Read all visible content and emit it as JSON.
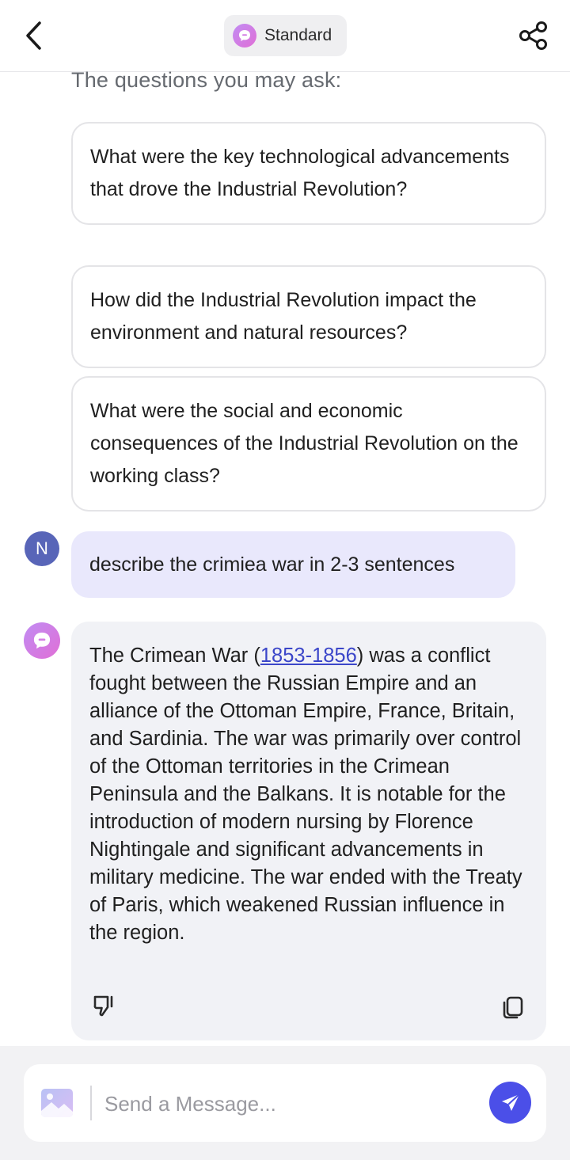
{
  "header": {
    "mode_label": "Standard"
  },
  "suggestions": {
    "title": "The questions you may ask:",
    "items": [
      "What were the key technological advancements that drove the Industrial Revolution?",
      "How did the Industrial Revolution impact the environment and natural resources?",
      "What were the social and economic consequences of the Industrial Revolution on the working class?"
    ]
  },
  "chat": {
    "user_initial": "N",
    "user_message": "describe the crimiea war in 2-3 sentences",
    "bot_reply": {
      "before_link": "The Crimean War (",
      "link_text": "1853-1856",
      "after_link": ") was a conflict fought between the Russian Empire and an alliance of the Ottoman Empire, France, Britain, and Sardinia. The war was primarily over control of the Ottoman territories in the Crimean Peninsula and the Balkans. It is notable for the introduction of modern nursing by Florence Nightingale and significant advancements in military medicine. The war ended with the Treaty of Paris, which weakened Russian influence in the region."
    }
  },
  "composer": {
    "placeholder": "Send a Message..."
  },
  "colors": {
    "accent": "#4b4fe8",
    "user_bubble": "#e9e8fc",
    "bot_bubble": "#f1f2f6",
    "link": "#3b46c9",
    "user_avatar": "#5865b8"
  },
  "icons": {
    "back": "chevron-left-icon",
    "mode": "chat-bubble-icon",
    "share": "share-icon",
    "thumb": "thumbs-down-icon",
    "copy": "copy-icon",
    "image": "image-icon",
    "send": "send-icon"
  }
}
